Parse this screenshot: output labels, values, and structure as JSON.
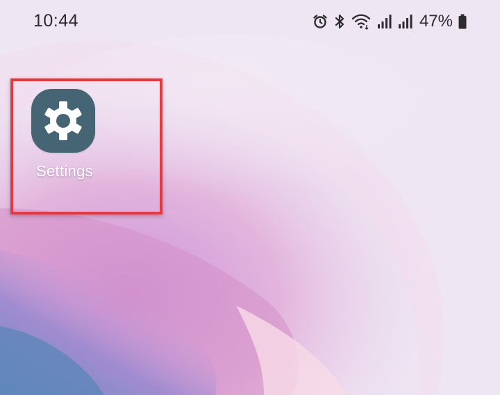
{
  "status_bar": {
    "time": "10:44",
    "battery_percent": "47%",
    "icons": [
      "alarm-icon",
      "bluetooth-icon",
      "wifi-icon",
      "signal-icon",
      "signal-icon",
      "battery-icon"
    ]
  },
  "home_screen": {
    "apps": [
      {
        "label": "Settings",
        "icon": "gear-icon",
        "icon_bg": "#456474"
      }
    ]
  },
  "annotation": {
    "highlight_color": "#e8383d"
  },
  "colors": {
    "wallpaper_base": "#efe6f3",
    "wallpaper_pink": "#d79ad0",
    "wallpaper_purple": "#a78ad0",
    "wallpaper_blue": "#6f93c0"
  }
}
